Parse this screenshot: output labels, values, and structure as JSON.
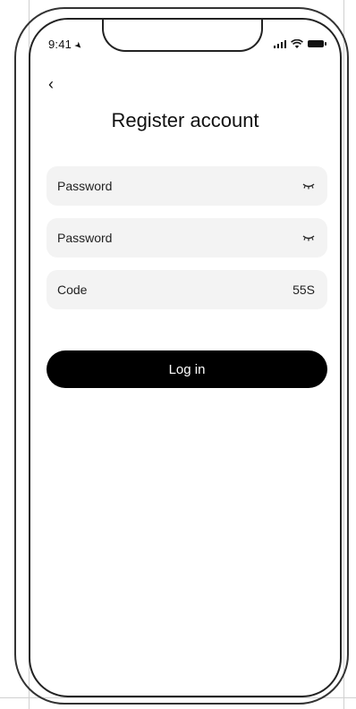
{
  "status_bar": {
    "time": "9:41",
    "location_icon": "location-arrow-icon",
    "signal_icon": "cellular-signal-icon",
    "wifi_icon": "wifi-icon",
    "battery_icon": "battery-icon"
  },
  "nav": {
    "back_label": "‹",
    "back_icon": "chevron-left-icon"
  },
  "page": {
    "title": "Register account"
  },
  "form": {
    "fields": [
      {
        "label": "Password",
        "suffix_icon": "eye-closed-icon"
      },
      {
        "label": "Password",
        "suffix_icon": "eye-closed-icon"
      },
      {
        "label": "Code",
        "suffix_text": "55S"
      }
    ],
    "submit_label": "Log in"
  },
  "colors": {
    "button_bg": "#000000",
    "field_bg": "#f3f3f3",
    "text": "#111111"
  }
}
